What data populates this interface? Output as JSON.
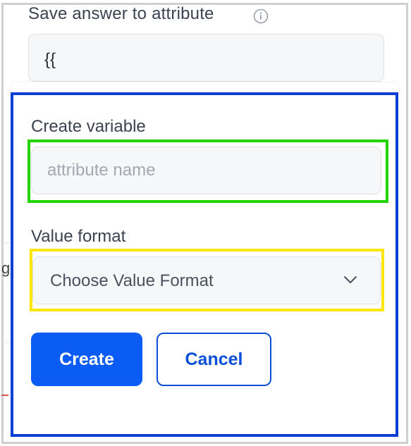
{
  "attribute_section": {
    "label": "Save answer to attribute",
    "info_icon": "info-circle-icon",
    "input_value": "{{"
  },
  "create_variable": {
    "label": "Create variable",
    "name_placeholder": "attribute name",
    "format_label": "Value format",
    "format_selected": "Choose Value Format",
    "dropdown_icon": "chevron-down-icon"
  },
  "actions": {
    "create_label": "Create",
    "cancel_label": "Cancel"
  },
  "background_fragment": {
    "text": "g"
  },
  "colors": {
    "primary": "#0b5cf5",
    "annotation_blue": "#0a3fd6",
    "annotation_green": "#22d400",
    "annotation_yellow": "#ffe600"
  }
}
